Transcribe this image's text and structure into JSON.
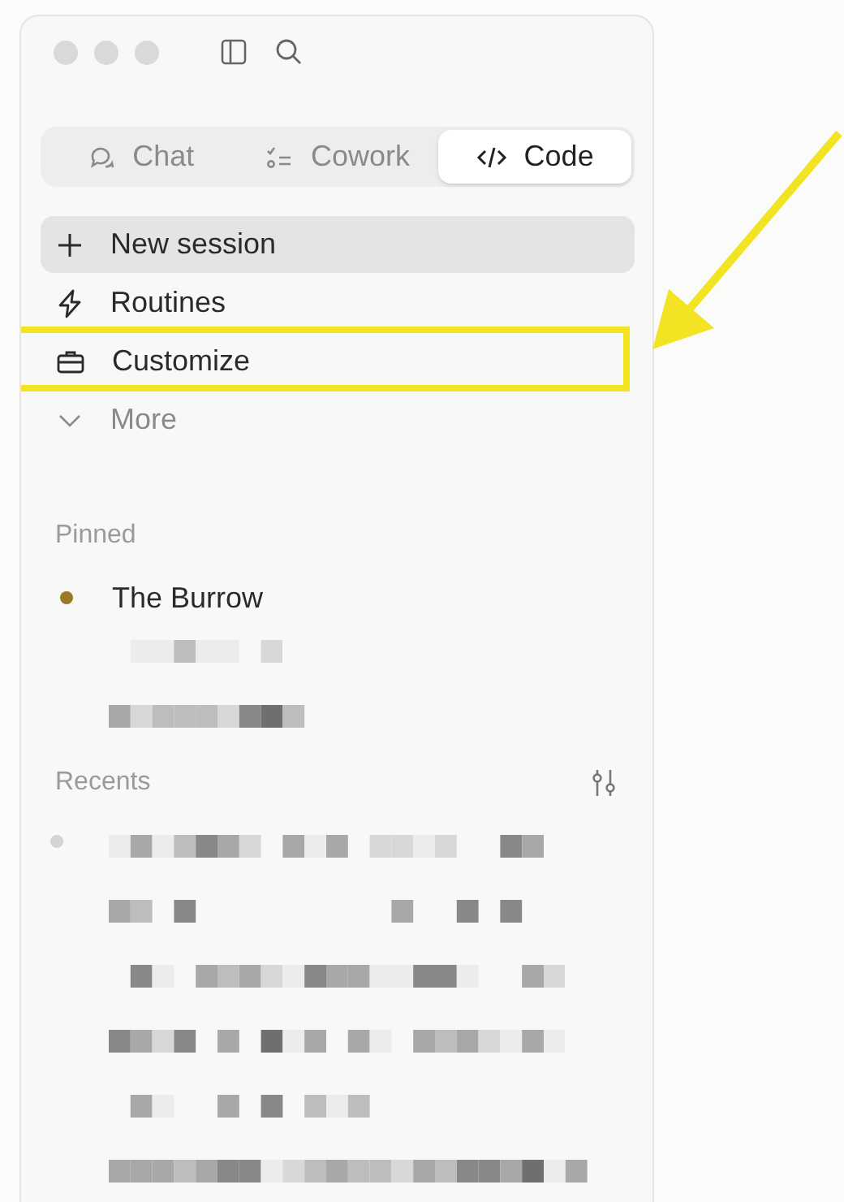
{
  "tabs": [
    {
      "label": "Chat",
      "kind": "chat",
      "selected": false
    },
    {
      "label": "Cowork",
      "kind": "tasks",
      "selected": false
    },
    {
      "label": "Code",
      "kind": "code",
      "selected": true
    }
  ],
  "nav": [
    {
      "label": "New session",
      "kind": "plus",
      "selected": true,
      "highlighted": false
    },
    {
      "label": "Routines",
      "kind": "bolt",
      "selected": false,
      "highlighted": false
    },
    {
      "label": "Customize",
      "kind": "briefcase",
      "selected": false,
      "highlighted": true
    },
    {
      "label": "More",
      "kind": "chevron",
      "selected": false,
      "highlighted": false
    }
  ],
  "pinned": {
    "label": "Pinned",
    "items": [
      {
        "title": "The Burrow",
        "color": "#9a7a25"
      }
    ]
  },
  "recents": {
    "label": "Recents"
  }
}
